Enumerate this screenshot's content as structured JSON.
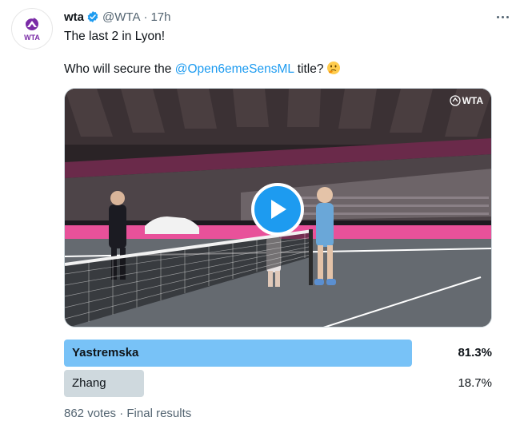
{
  "tweet": {
    "author_name": "wta",
    "handle": "@WTA",
    "separator": "·",
    "time": "17h",
    "avatar_text": "WTA",
    "line1": "The last 2 in Lyon!",
    "line2_before": "Who will secure the ",
    "mention": "@Open6emeSensML",
    "line2_after": " title?",
    "emoji": "thinking-face-icon"
  },
  "media": {
    "watermark": "WTA",
    "play_icon": "play-icon"
  },
  "poll": {
    "options": [
      {
        "label": "Yastremska",
        "percent_text": "81.3%",
        "percent": 81.3,
        "winner": true
      },
      {
        "label": "Zhang",
        "percent_text": "18.7%",
        "percent": 18.7,
        "winner": false
      }
    ],
    "votes": "862 votes",
    "separator": "·",
    "status": "Final results"
  },
  "colors": {
    "accent": "#1d9bf0",
    "winner_bar": "#78c2f7",
    "loser_bar": "#cfd9de",
    "secondary_text": "#536471",
    "court_pink": "#e8519a"
  }
}
